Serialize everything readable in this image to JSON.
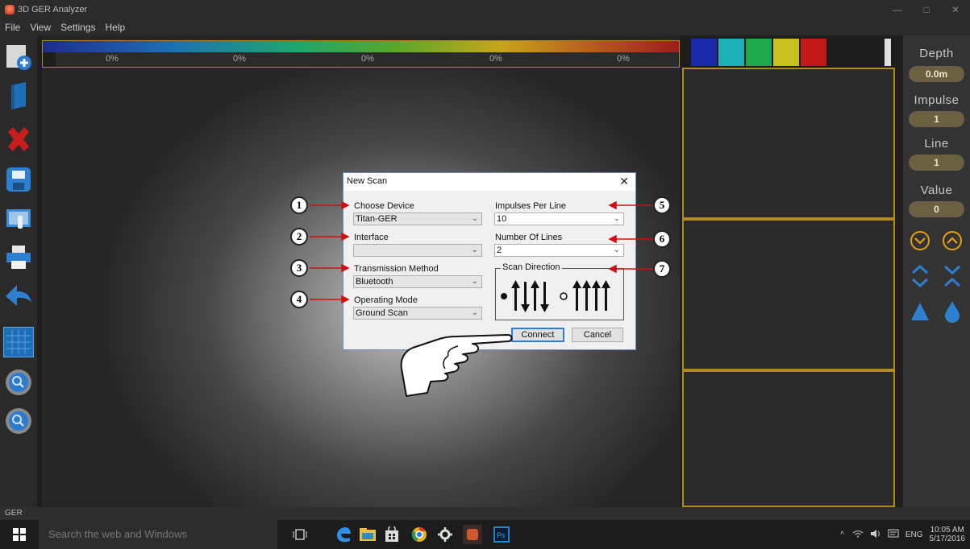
{
  "window": {
    "title": "3D GER Analyzer",
    "controls": [
      "—",
      "□",
      "✕"
    ]
  },
  "menu": [
    "File",
    "View",
    "Settings",
    "Help"
  ],
  "left_toolbar": [
    {
      "name": "add-scan-icon"
    },
    {
      "name": "open-book-icon"
    },
    {
      "name": "delete-icon"
    },
    {
      "name": "save-icon"
    },
    {
      "name": "screen-touch-icon"
    },
    {
      "name": "print-icon"
    },
    {
      "name": "back-arrow-icon"
    },
    {
      "name": "grid-view-icon"
    },
    {
      "name": "zoom-out-icon"
    },
    {
      "name": "zoom-in-icon"
    }
  ],
  "color_scale": {
    "percentages": [
      "0%",
      "0%",
      "0%",
      "0%",
      "0%"
    ]
  },
  "swatches": [
    "#1a2aa8",
    "#1fb0b8",
    "#1fa84a",
    "#c8c01c",
    "#c21818"
  ],
  "right_sidebar": {
    "depth_label": "Depth",
    "depth_value": "0.0m",
    "impulse_label": "Impulse",
    "impulse_value": "1",
    "line_label": "Line",
    "line_value": "1",
    "value_label": "Value",
    "value_value": "0"
  },
  "status_bar": {
    "text": "GER"
  },
  "dialog": {
    "title": "New Scan",
    "close": "✕",
    "choose_device_label": "Choose Device",
    "choose_device_value": "Titan-GER",
    "interface_label": "Interface",
    "interface_value": "",
    "transmission_label": "Transmission Method",
    "transmission_value": "Bluetooth",
    "operating_mode_label": "Operating Mode",
    "operating_mode_value": "Ground Scan",
    "impulses_label": "Impulses Per Line",
    "impulses_value": "10",
    "lines_label": "Number Of Lines",
    "lines_value": "2",
    "scan_direction_label": "Scan Direction",
    "scan_direction_selected": "zigzag",
    "connect_label": "Connect",
    "cancel_label": "Cancel"
  },
  "callouts": [
    "1",
    "2",
    "3",
    "4",
    "5",
    "6",
    "7"
  ],
  "taskbar": {
    "search_placeholder": "Search the web and Windows",
    "language": "ENG",
    "time": "10:05 AM",
    "date": "5/17/2016"
  },
  "colors": {
    "accent_gold": "#b08a20",
    "callout_arrow": "#d01010",
    "connect_border": "#2d7fd3"
  }
}
